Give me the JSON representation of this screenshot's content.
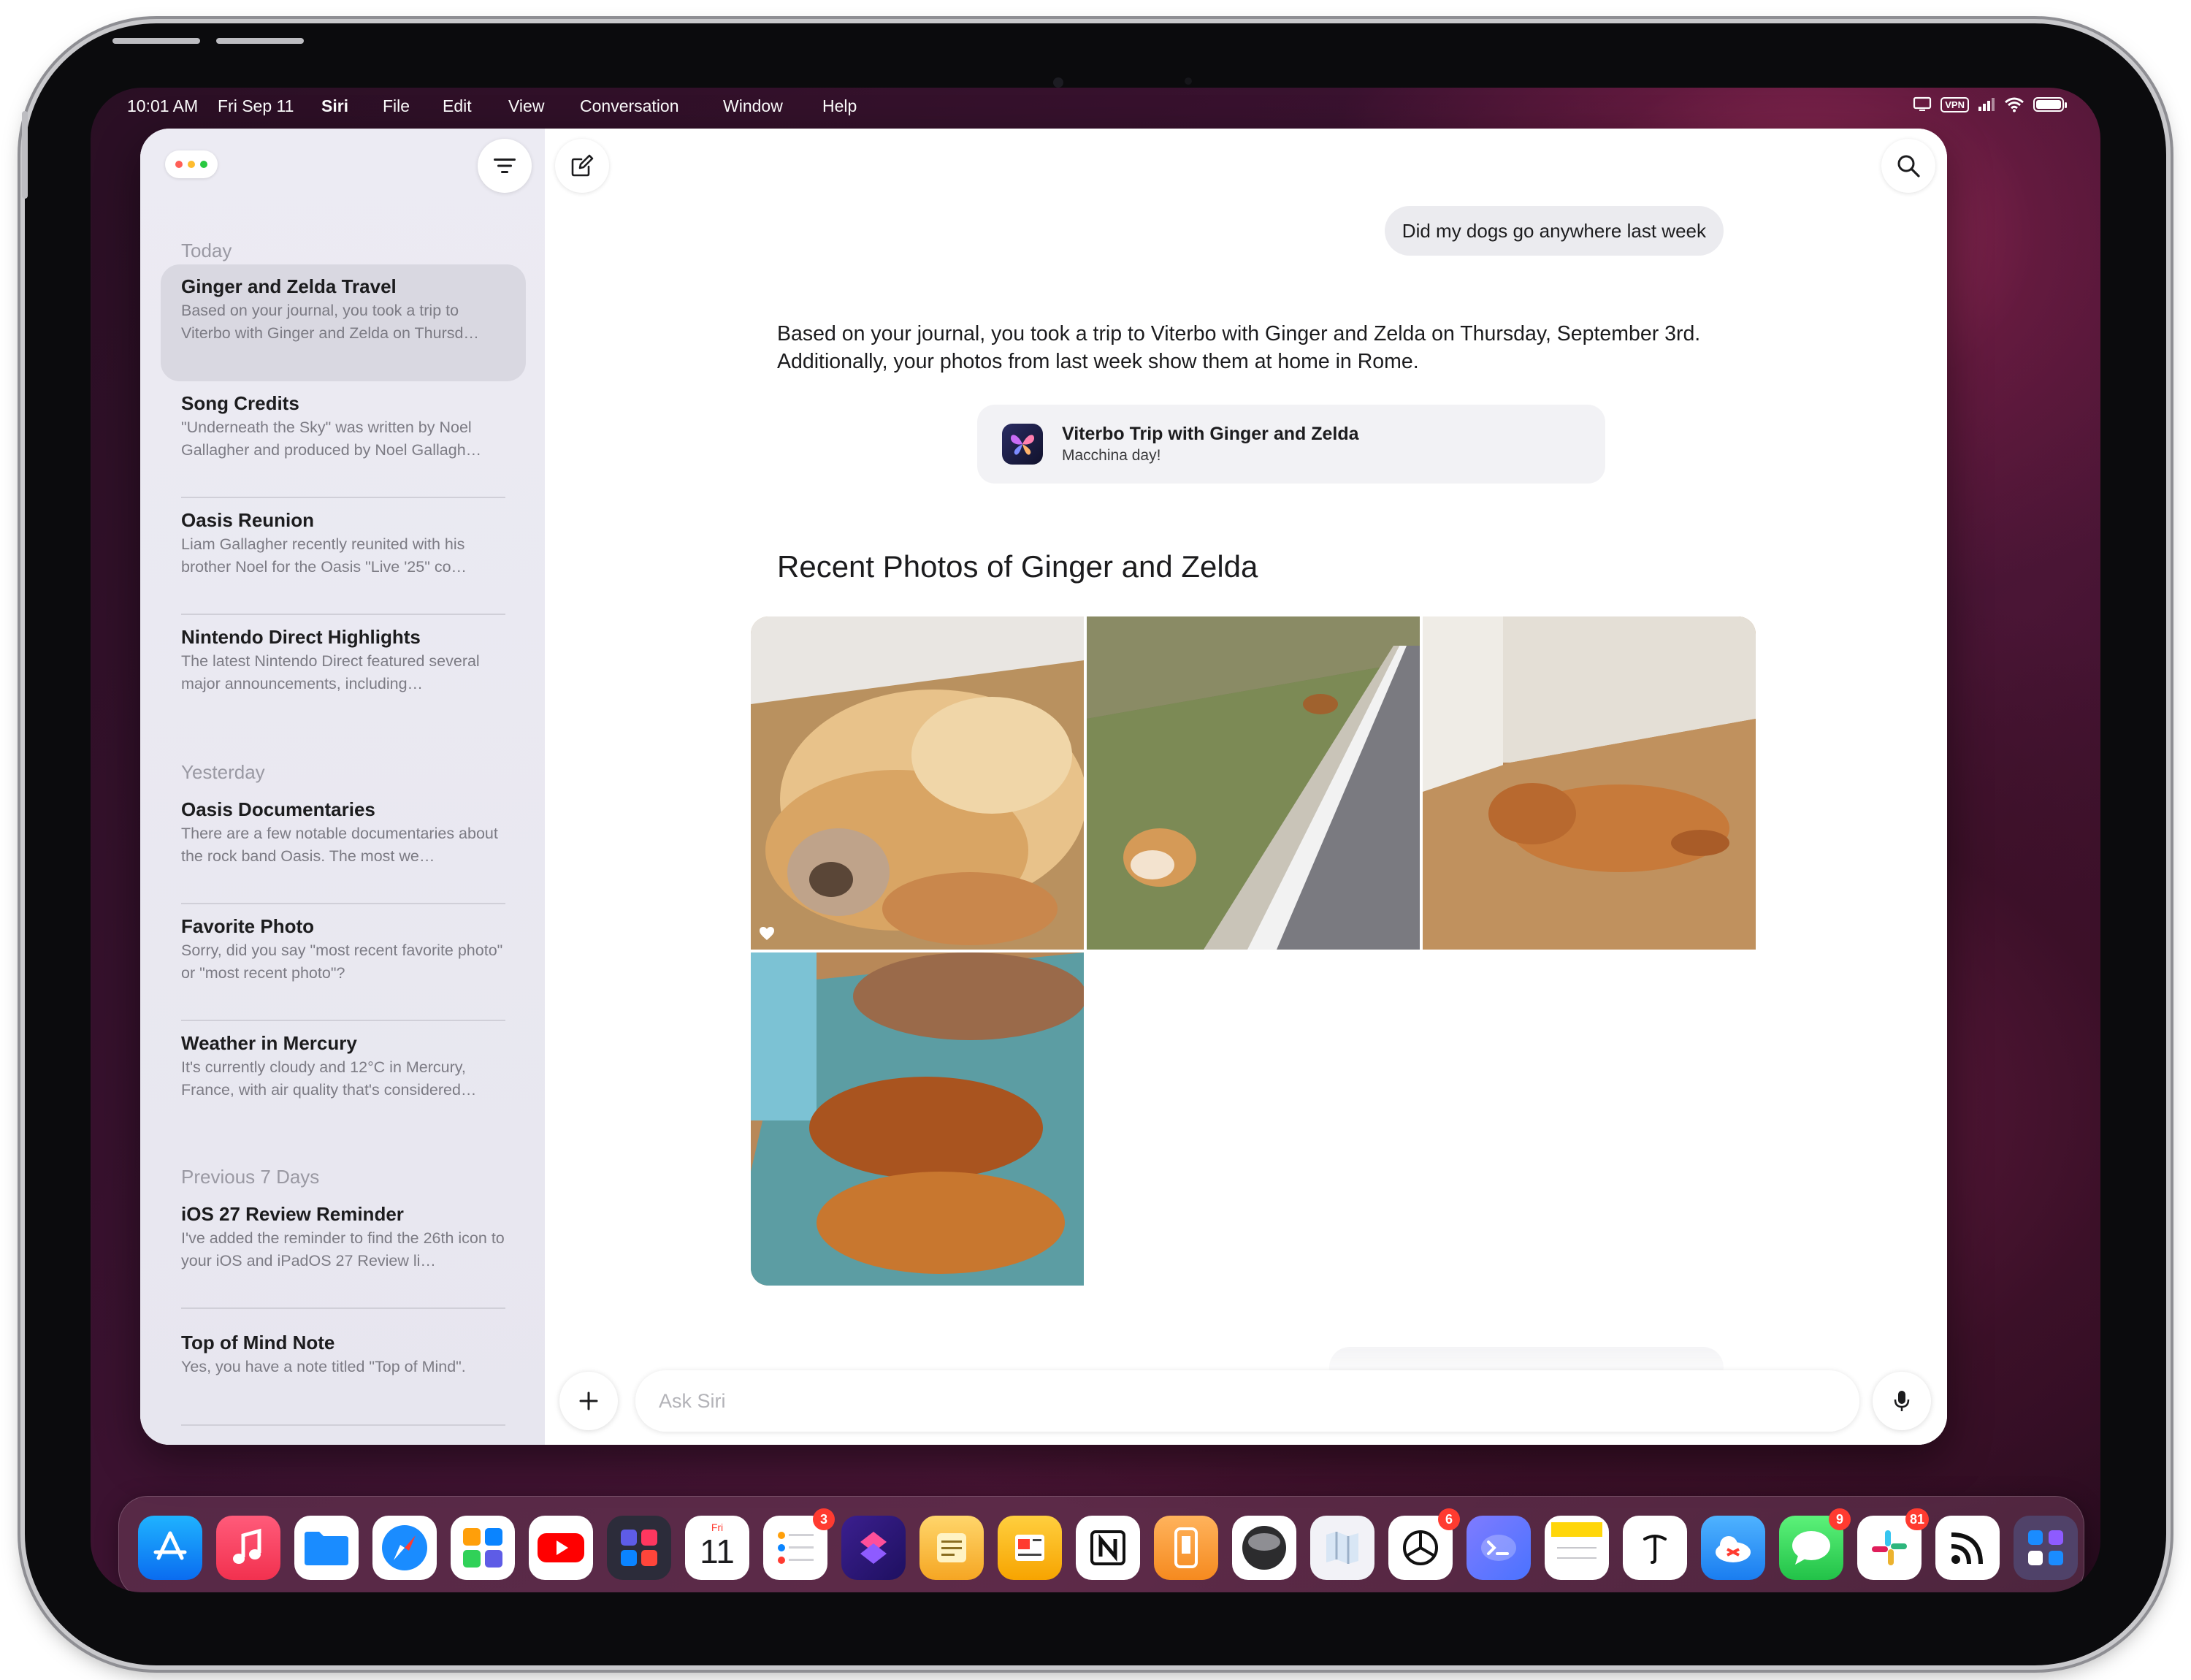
{
  "menubar": {
    "time": "10:01 AM",
    "date": "Fri Sep 11",
    "app_name": "Siri",
    "menus": [
      "File",
      "Edit",
      "View",
      "Conversation",
      "Window",
      "Help"
    ],
    "vpn_label": "VPN"
  },
  "sidebar": {
    "sections": [
      {
        "label": "Today"
      },
      {
        "label": "Yesterday"
      },
      {
        "label": "Previous 7 Days"
      }
    ],
    "conversations": [
      {
        "title": "Ginger and Zelda Travel",
        "snippet": "Based on your journal, you took a trip to Viterbo with Ginger and Zelda on Thursd…",
        "selected": true
      },
      {
        "title": "Song Credits",
        "snippet": "\"Underneath the Sky\" was written by Noel Gallagher and produced by Noel Gallagh…"
      },
      {
        "title": "Oasis Reunion",
        "snippet": "Liam Gallagher recently reunited with his brother Noel for the Oasis \"Live '25\" co…"
      },
      {
        "title": "Nintendo Direct Highlights",
        "snippet": "The latest Nintendo Direct featured several major announcements, including…"
      },
      {
        "title": "Oasis Documentaries",
        "snippet": "There are a few notable documentaries about the rock band Oasis. The most we…"
      },
      {
        "title": "Favorite Photo",
        "snippet": "Sorry, did you say \"most recent favorite photo\" or \"most recent photo\"?"
      },
      {
        "title": "Weather in Mercury",
        "snippet": "It's currently cloudy and 12°C in Mercury, France, with air quality that's considered…"
      },
      {
        "title": "iOS 27 Review Reminder",
        "snippet": "I've added the reminder to find the 26th icon to your iOS and iPadOS 27 Review li…"
      },
      {
        "title": "Top of Mind Note",
        "snippet": "Yes, you have a note titled \"Top of Mind\"."
      }
    ]
  },
  "chat": {
    "user_message": "Did my dogs go anywhere last week",
    "answer_line1": "Based on your journal, you took a trip to Viterbo with Ginger and Zelda on Thursday, September 3rd.",
    "answer_line2": "Additionally, your photos from last week show them at home in Rome.",
    "journal_card": {
      "title": "Viterbo Trip with Ginger and Zelda",
      "subtitle": "Macchina day!",
      "icon": "journal-app-icon"
    },
    "photos_heading": "Recent Photos of Ginger and Zelda",
    "photos": [
      {
        "name": "dogs-sleeping-fluffy",
        "favorite": true
      },
      {
        "name": "dog-walking-roadside",
        "favorite": false
      },
      {
        "name": "dog-lying-floor",
        "favorite": false
      },
      {
        "name": "dogs-on-couch",
        "favorite": false
      }
    ]
  },
  "composer": {
    "placeholder": "Ask Siri"
  },
  "dock": {
    "apps": [
      {
        "name": "app-store-icon",
        "badge": ""
      },
      {
        "name": "music-icon",
        "badge": ""
      },
      {
        "name": "files-icon",
        "badge": ""
      },
      {
        "name": "safari-icon",
        "badge": ""
      },
      {
        "name": "widgets-app-icon",
        "badge": ""
      },
      {
        "name": "youtube-icon",
        "badge": ""
      },
      {
        "name": "remote-control-icon",
        "badge": ""
      },
      {
        "name": "calendar-icon",
        "badge": "",
        "day_label": "Fri",
        "day_number": "11"
      },
      {
        "name": "reminders-icon",
        "badge": "3"
      },
      {
        "name": "shortcuts-icon",
        "badge": ""
      },
      {
        "name": "notes-app-icon",
        "badge": ""
      },
      {
        "name": "news-reader-icon",
        "badge": ""
      },
      {
        "name": "notion-icon",
        "badge": ""
      },
      {
        "name": "device-mirror-icon",
        "badge": ""
      },
      {
        "name": "sphere-app-icon",
        "badge": ""
      },
      {
        "name": "maps-icon",
        "badge": ""
      },
      {
        "name": "chatgpt-icon",
        "badge": "6"
      },
      {
        "name": "terminal-chat-icon",
        "badge": ""
      },
      {
        "name": "notes-icon",
        "badge": ""
      },
      {
        "name": "writing-app-icon",
        "badge": ""
      },
      {
        "name": "weather-cloud-icon",
        "badge": ""
      },
      {
        "name": "messages-icon",
        "badge": "9"
      },
      {
        "name": "slack-icon",
        "badge": "81"
      },
      {
        "name": "rss-reader-icon",
        "badge": ""
      },
      {
        "name": "app-library-icon",
        "badge": ""
      }
    ]
  },
  "colors": {
    "accent_red": "#ff3b30",
    "selected_row": "#d9d8e1",
    "sidebar_bg": "#ecebf3",
    "user_bubble": "#ebebef"
  }
}
